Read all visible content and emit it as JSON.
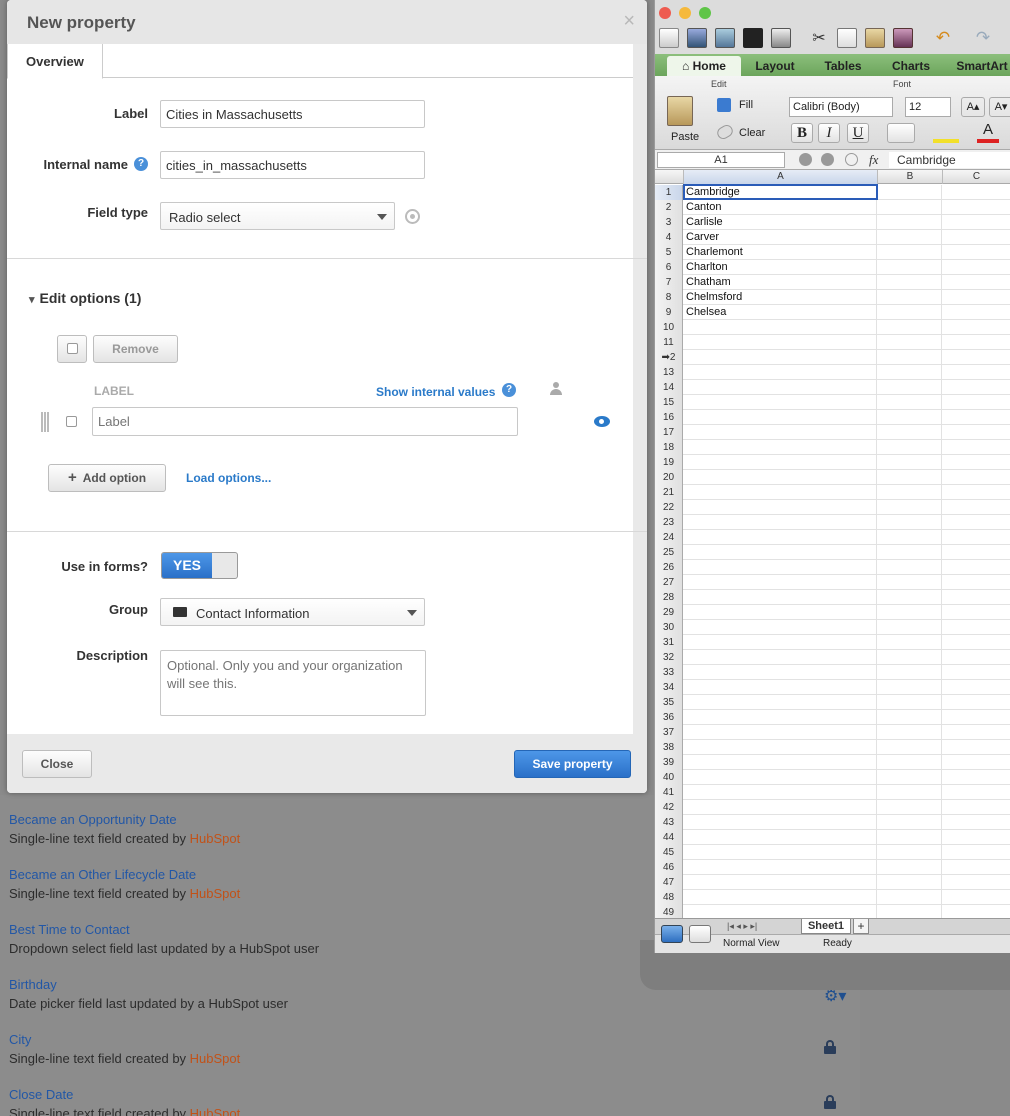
{
  "modal": {
    "title": "New property",
    "close_glyph": "×",
    "tab_overview": "Overview",
    "label_field": {
      "label": "Label",
      "value": "Cities in Massachusetts"
    },
    "internal_name": {
      "label": "Internal name",
      "value": "cities_in_massachusetts",
      "help": "?"
    },
    "field_type": {
      "label": "Field type",
      "value": "Radio select"
    },
    "edit_options": {
      "toggle": "▾",
      "title": "Edit options (1)"
    },
    "remove_label": "Remove",
    "options_header": {
      "label": "LABEL",
      "show_internal": "Show internal values",
      "help": "?"
    },
    "option_placeholder": "Label",
    "add_option": "Add option",
    "add_glyph": "+",
    "load_options": "Load options...",
    "use_in_forms": {
      "label": "Use in forms?",
      "value": "YES"
    },
    "group": {
      "label": "Group",
      "value": "Contact Information"
    },
    "description": {
      "label": "Description",
      "placeholder": "Optional. Only you and your organization will see this."
    },
    "close_button": "Close",
    "save_button": "Save property"
  },
  "background_list": {
    "items": [
      {
        "title": "Became an Opportunity Date",
        "sub": "Single-line text field created by ",
        "by": "HubSpot",
        "by_type": "hubspot"
      },
      {
        "title": "Became an Other Lifecycle Date",
        "sub": "Single-line text field created by ",
        "by": "HubSpot",
        "by_type": "hubspot"
      },
      {
        "title": "Best Time to Contact",
        "sub": "Dropdown select field last updated by ",
        "by": "a HubSpot user",
        "by_type": "user"
      },
      {
        "title": "Birthday",
        "sub": "Date picker field last updated by ",
        "by": "a HubSpot user",
        "by_type": "user"
      },
      {
        "title": "City",
        "sub": "Single-line text field created by ",
        "by": "HubSpot",
        "by_type": "hubspot"
      },
      {
        "title": "Close Date",
        "sub": "Single-line text field created by ",
        "by": "HubSpot",
        "by_type": "hubspot"
      }
    ],
    "gear_glyph": "⚙▾"
  },
  "excel": {
    "ribbon_tabs": [
      "Home",
      "Layout",
      "Tables",
      "Charts",
      "SmartArt"
    ],
    "home_glyph": "⌂",
    "groups": {
      "edit": "Edit",
      "font": "Font"
    },
    "paste": "Paste",
    "fill": "Fill",
    "clear": "Clear",
    "font_name": "Calibri (Body)",
    "font_size": "12",
    "bold": "B",
    "italic": "I",
    "underline": "U",
    "grow_font": "A▴",
    "shrink_font": "A▾",
    "font_color_glyph": "A",
    "name_box": "A1",
    "fx_glyph": "fx",
    "formula_value": "Cambridge",
    "columns": [
      "A",
      "B",
      "C"
    ],
    "rows": [
      "1",
      "2",
      "3",
      "4",
      "5",
      "6",
      "7",
      "8",
      "9",
      "10",
      "11",
      "➡2",
      "13",
      "14",
      "15",
      "16",
      "17",
      "18",
      "19",
      "20",
      "21",
      "22",
      "23",
      "24",
      "25",
      "26",
      "27",
      "28",
      "29",
      "30",
      "31",
      "32",
      "33",
      "34",
      "35",
      "36",
      "37",
      "38",
      "39",
      "40",
      "41",
      "42",
      "43",
      "44",
      "45",
      "46",
      "47",
      "48",
      "49"
    ],
    "cells": [
      "Cambridge",
      "Canton",
      "Carlisle",
      "Carver",
      "Charlemont",
      "Charlton",
      "Chatham",
      "Chelmsford",
      "Chelsea"
    ],
    "sheet_nav": "|◂ ◂ ▸ ▸|",
    "sheet_tab": "Sheet1",
    "add_sheet": "+",
    "status_view": "Normal View",
    "status_ready": "Ready",
    "colors": {
      "ribbon_green": "#7bb26b",
      "selection": "#2a5cb8"
    }
  },
  "colors": {
    "link_blue": "#2a7ac9",
    "primary": "#3a86dc",
    "hubspot_orange": "#c25218"
  }
}
